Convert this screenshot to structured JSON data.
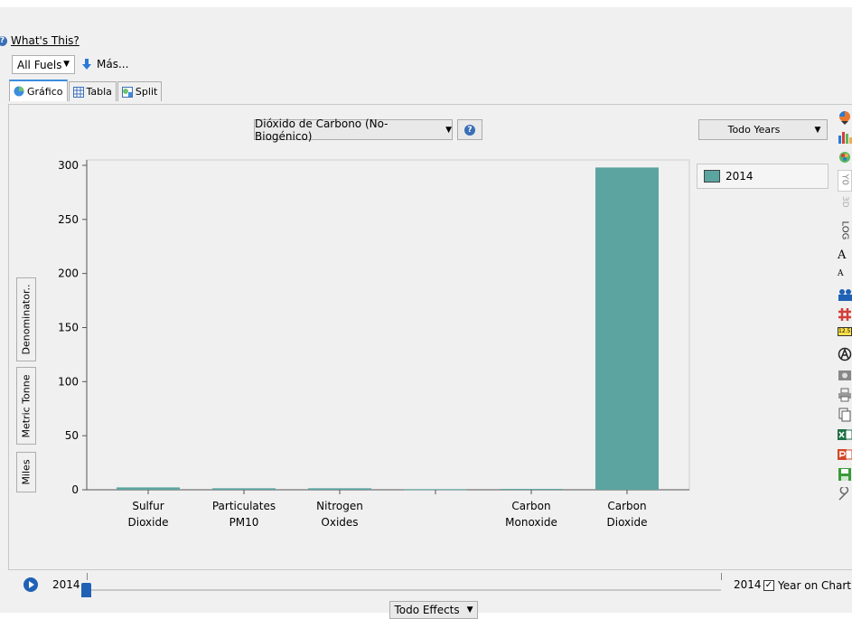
{
  "header": {
    "help_link": "What's This?",
    "fuel_select": "All Fuels",
    "more_button": "Más..."
  },
  "tabs": [
    {
      "label": "Gráfico",
      "active": true
    },
    {
      "label": "Tabla",
      "active": false
    },
    {
      "label": "Split",
      "active": false
    }
  ],
  "toolbar": {
    "measure_select": "Dióxido de Carbono (No-Biogénico)",
    "years_select": "Todo Years",
    "effects_select": "Todo Effects"
  },
  "side_buttons": {
    "denominator": "Denominator..",
    "units": "Metric Tonne",
    "distance": "Miles"
  },
  "right_toolbar": {
    "yo_label": "Y0",
    "three_d_label": "3D",
    "log_label": "LOG",
    "font_large": "A",
    "font_small": "A",
    "decimal_badge": "12.5"
  },
  "timeline": {
    "start_year": "2014",
    "end_year": "2014",
    "year_on_chart_label": "Year on Chart",
    "year_on_chart_checked": true
  },
  "chart_data": {
    "type": "bar",
    "categories": [
      [
        "Sulfur",
        "Dioxide"
      ],
      [
        "Particulates",
        "PM10"
      ],
      [
        "Nitrogen",
        "Oxides"
      ],
      [
        "",
        ""
      ],
      [
        "Carbon",
        "Monoxide"
      ],
      [
        "Carbon",
        "Dioxide"
      ]
    ],
    "series": [
      {
        "name": "2014",
        "color": "#5ba4a0",
        "values": [
          2.2,
          1.4,
          1.4,
          0.6,
          0.8,
          298
        ]
      }
    ],
    "ylim": [
      0,
      305
    ],
    "yticks": [
      0,
      50,
      100,
      150,
      200,
      250,
      300
    ],
    "grid": false,
    "legend": "right"
  }
}
